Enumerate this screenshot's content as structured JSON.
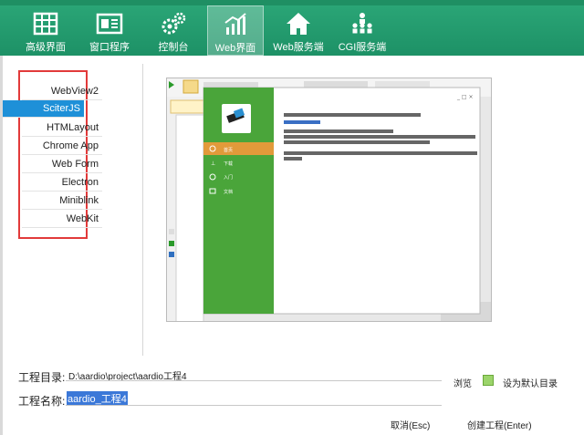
{
  "toolbar": {
    "items": [
      {
        "label": "高级界面",
        "icon": "grid-table-icon"
      },
      {
        "label": "窗口程序",
        "icon": "window-app-icon"
      },
      {
        "label": "控制台",
        "icon": "gears-icon"
      },
      {
        "label": "Web界面",
        "icon": "bar-chart-icon"
      },
      {
        "label": "Web服务端",
        "icon": "house-icon"
      },
      {
        "label": "CGI服务端",
        "icon": "users-network-icon"
      }
    ],
    "active_index": 3
  },
  "sidebar": {
    "items": [
      "WebView2",
      "SciterJS",
      "HTMLayout",
      "Chrome App",
      "Web Form",
      "Electron",
      "Miniblink",
      "WebKit"
    ],
    "selected": "SciterJS"
  },
  "preview": {
    "app": {
      "menu": [
        {
          "label": "首页",
          "icon": "target-icon"
        },
        {
          "label": "下载",
          "icon": "download-icon"
        },
        {
          "label": "入门",
          "icon": "compass-icon"
        },
        {
          "label": "文档",
          "icon": "folder-icon"
        }
      ],
      "content_lines": [
        "在超链接的URL前面加上tabs://的前缀,例如",
        "tabs://about://blank",
        "",
        "然后在超链接的title属性中指定新建选项卡的标题,",
        "最后指定用target属性指定目标选项卡的名字,\"_blank\"表示新建选项卡",
        "符合以上条件的超链接 - 点击则会在选项卡页面中打开.",
        "",
        "这种动态创建的选项卡,默认会添加一个关闭按钮,注意这个按钮在CSS中要指定 float:right 以向右浮动"
      ]
    }
  },
  "form": {
    "project_dir_label": "工程目录:",
    "project_dir_value": "D:\\aardio\\project\\aardio工程4",
    "project_name_label": "工程名称:",
    "project_name_value": "aardio_工程4",
    "browse_label": "浏览",
    "default_dir_label": "设为默认目录",
    "cancel_label": "取消(Esc)",
    "create_label": "创建工程(Enter)"
  },
  "colors": {
    "accent": "#1f9a6c",
    "selection": "#1e90d8",
    "highlight": "#e23a3a",
    "app_green": "#4aa53a"
  }
}
